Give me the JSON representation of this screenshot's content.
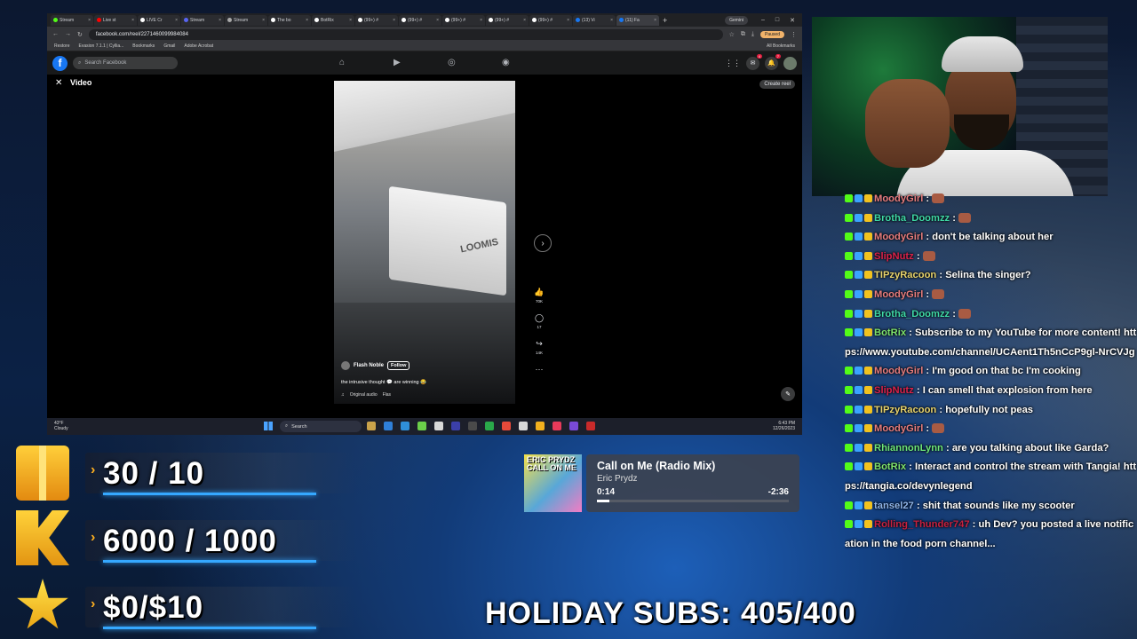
{
  "browser": {
    "tabs": [
      {
        "label": "Stream",
        "color": "#53fc18"
      },
      {
        "label": "Live st",
        "color": "#ff0000"
      },
      {
        "label": "LIVE Cr",
        "color": "#ffffff"
      },
      {
        "label": "Stream",
        "color": "#5865f2"
      },
      {
        "label": "Stream",
        "color": "#aaaaaa"
      },
      {
        "label": "The bo",
        "color": "#ffffff"
      },
      {
        "label": "BotRix",
        "color": "#ffffff"
      },
      {
        "label": "(99+) #",
        "color": "#ffffff"
      },
      {
        "label": "(99+) #",
        "color": "#ffffff"
      },
      {
        "label": "(99+) #",
        "color": "#ffffff"
      },
      {
        "label": "(99+) #",
        "color": "#ffffff"
      },
      {
        "label": "(99+) #",
        "color": "#ffffff"
      },
      {
        "label": "(13) Vi",
        "color": "#1877f2"
      },
      {
        "label": "(11) Fa",
        "color": "#1877f2"
      }
    ],
    "new_tab": "+",
    "gemini": "Gemini",
    "url": "facebook.com/reel/2271460099984084",
    "profile": "Paused",
    "bookmarks": [
      "Restore",
      "Evasion 7.1.1 | Cyllia...",
      "Bookmarks",
      "Gmail",
      "Adobe Acrobat"
    ],
    "all_bookmarks": "All Bookmarks"
  },
  "facebook": {
    "logo": "f",
    "search_placeholder": "Search Facebook",
    "messenger_badge": "4",
    "notif_badge": "7",
    "viewer_title": "Video",
    "create_reel": "Create reel",
    "video": {
      "truck_text": "LOOMIS",
      "username": "Flash Noble",
      "follow": "Follow",
      "caption": "the intrusive thought 💬 are winning 😂",
      "audio": "Original audio",
      "audio_author": "Flas",
      "likes": "70K",
      "comments": "17",
      "shares": "14K"
    }
  },
  "taskbar": {
    "weather_temp": "43°F",
    "weather_desc": "Cloudy",
    "search": "Search",
    "time": "6:43 PM",
    "date": "12/26/2023"
  },
  "goals": [
    {
      "text": "30 / 10",
      "icon": "gift-icon"
    },
    {
      "text": "6000 / 1000",
      "icon": "kick-icon"
    },
    {
      "text": "$0/$10",
      "icon": "star-icon"
    }
  ],
  "now_playing": {
    "art_text": "ERIC PRYDZ CALL ON ME",
    "title": "Call on Me (Radio Mix)",
    "artist": "Eric Prydz",
    "current": "0:14",
    "remaining": "-2:36",
    "progress": 0.065
  },
  "holiday_subs": "HOLIDAY SUBS: 405/400",
  "chat": [
    {
      "user": "MoodyGirl",
      "color": "#e87d7d",
      "text": " : ",
      "emote": true
    },
    {
      "user": "Brotha_Doomzz",
      "color": "#3fd9a6",
      "text": " : ",
      "emote": true
    },
    {
      "user": "MoodyGirl",
      "color": "#e87d7d",
      "text": " : don't be talking about her",
      "emote": false
    },
    {
      "user": "SlipNutz",
      "color": "#d9224a",
      "text": " : ",
      "emote": true
    },
    {
      "user": "TIPzyRacoon",
      "color": "#e8d36b",
      "text": " : Selina the singer?",
      "emote": false
    },
    {
      "user": "MoodyGirl",
      "color": "#e87d7d",
      "text": " : ",
      "emote": true
    },
    {
      "user": "Brotha_Doomzz",
      "color": "#3fd9a6",
      "text": " : ",
      "emote": true
    },
    {
      "user": "BotRix",
      "color": "#7ee26b",
      "text": " : Subscribe to my YouTube for more content! https://www.youtube.com/channel/UCAent1Th5nCcP9gl-NrCVJg",
      "emote": false
    },
    {
      "user": "MoodyGirl",
      "color": "#e87d7d",
      "text": " : I'm good on that bc I'm cooking",
      "emote": false
    },
    {
      "user": "SlipNutz",
      "color": "#d9224a",
      "text": " : I can smell that explosion from here",
      "emote": false
    },
    {
      "user": "TIPzyRacoon",
      "color": "#e8d36b",
      "text": " : hopefully not peas",
      "emote": false
    },
    {
      "user": "MoodyGirl",
      "color": "#e87d7d",
      "text": " : ",
      "emote": true
    },
    {
      "user": "RhiannonLynn",
      "color": "#6ee87a",
      "text": " : are you talking about like Garda?",
      "emote": false
    },
    {
      "user": "BotRix",
      "color": "#7ee26b",
      "text": " : Interact and control the stream with Tangia! https://tangia.co/devynlegend",
      "emote": false
    },
    {
      "user": "tansel27",
      "color": "#8fb4e8",
      "text": " : shit that sounds like my scooter",
      "emote": false
    },
    {
      "user": "Rolling_Thunder747",
      "color": "#c8203f",
      "text": " : uh Dev? you posted a live notification in the food porn channel...",
      "emote": false
    }
  ]
}
